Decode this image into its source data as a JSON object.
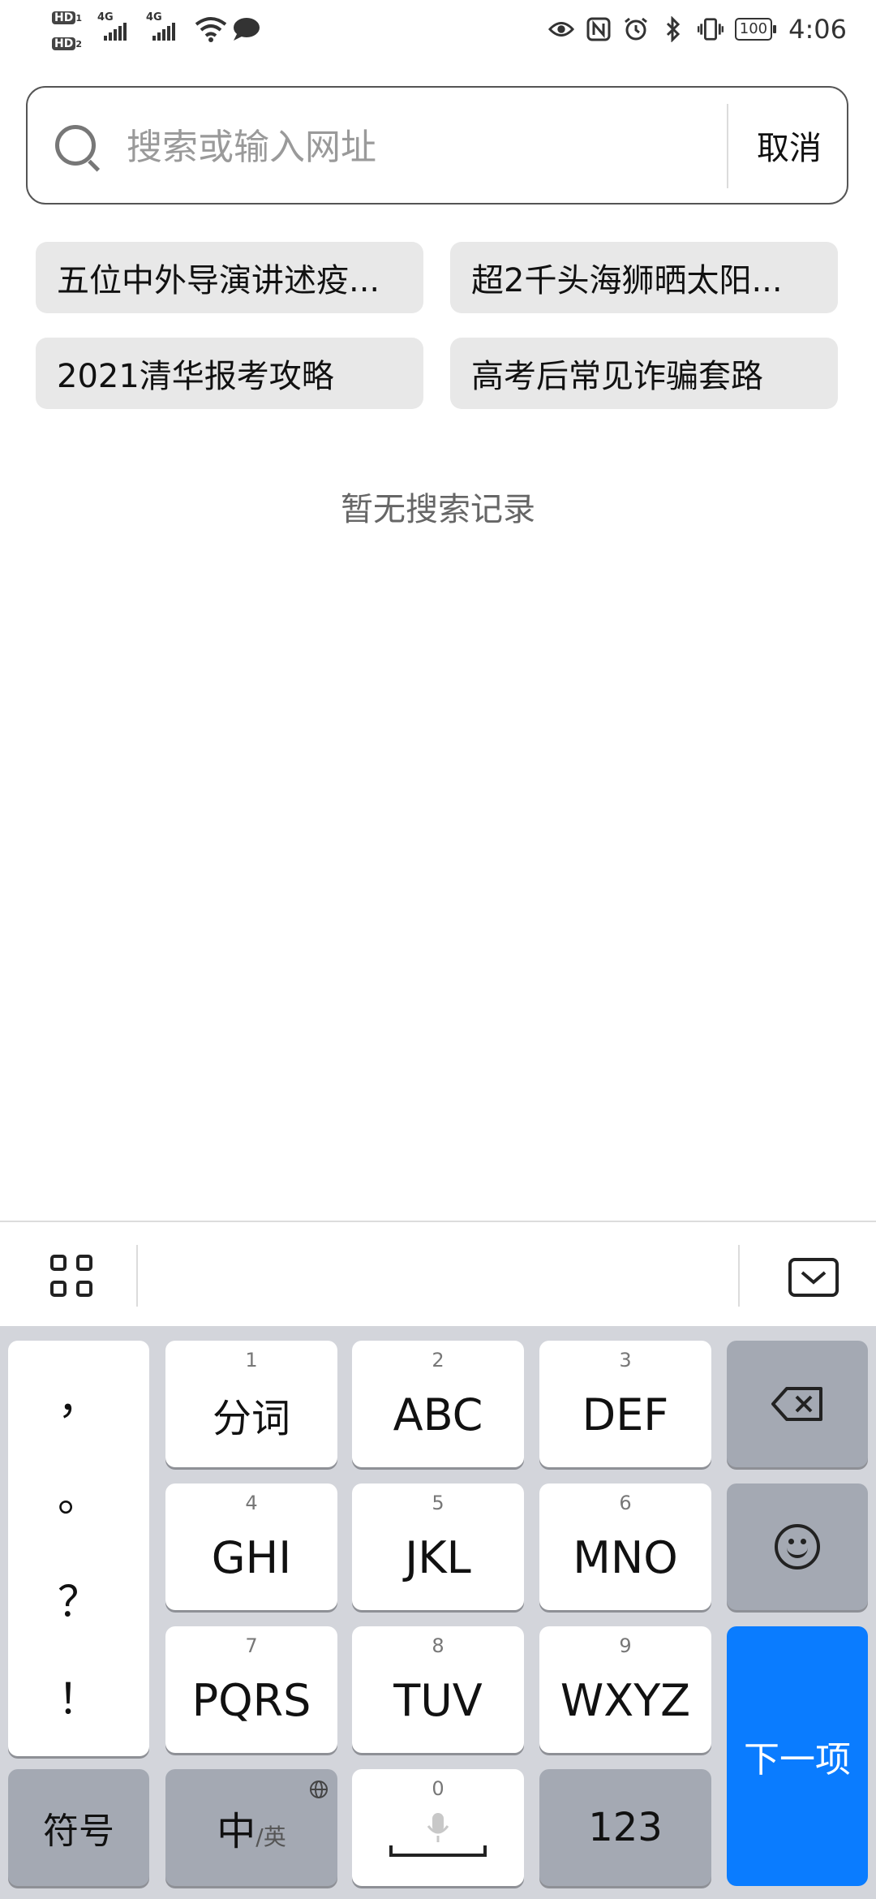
{
  "status_bar": {
    "hd1": "HD",
    "hd2": "HD",
    "net1": "4G",
    "net2": "4G",
    "battery": "100",
    "time": "4:06"
  },
  "search": {
    "placeholder": "搜索或输入网址",
    "cancel_label": "取消"
  },
  "hot_searches": [
    "五位中外导演讲述疫...",
    "超2千头海狮晒太阳...",
    "2021清华报考攻略",
    "高考后常见诈骗套路"
  ],
  "empty_history": "暂无搜索记录",
  "keyboard": {
    "punctuation": [
      "，",
      "。",
      "？",
      "！"
    ],
    "keys": [
      {
        "num": "1",
        "label": "分词"
      },
      {
        "num": "2",
        "label": "ABC"
      },
      {
        "num": "3",
        "label": "DEF"
      },
      {
        "num": "4",
        "label": "GHI"
      },
      {
        "num": "5",
        "label": "JKL"
      },
      {
        "num": "6",
        "label": "MNO"
      },
      {
        "num": "7",
        "label": "PQRS"
      },
      {
        "num": "8",
        "label": "TUV"
      },
      {
        "num": "9",
        "label": "WXYZ"
      }
    ],
    "symbol_label": "符号",
    "lang_main": "中",
    "lang_sub": "/英",
    "space_num": "0",
    "num_label": "123",
    "next_label": "下一项"
  }
}
